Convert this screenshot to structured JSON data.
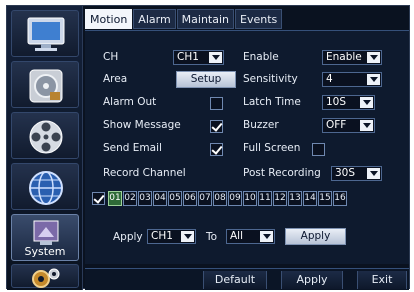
{
  "sidebar": {
    "items": [
      {
        "icon": "monitor-icon",
        "label": ""
      },
      {
        "icon": "hard-disk-icon",
        "label": ""
      },
      {
        "icon": "film-reel-icon",
        "label": ""
      },
      {
        "icon": "network-globe-icon",
        "label": ""
      },
      {
        "icon": "system-icon",
        "label": "System"
      },
      {
        "icon": "gears-icon",
        "label": ""
      }
    ]
  },
  "tabs": [
    "Motion",
    "Alarm",
    "Maintain",
    "Events"
  ],
  "form": {
    "ch_label": "CH",
    "ch_value": "CH1",
    "enable_label": "Enable",
    "enable_value": "Enable",
    "area_label": "Area",
    "setup_button": "Setup",
    "sensitivity_label": "Sensitivity",
    "sensitivity_value": "4",
    "alarm_out_label": "Alarm Out",
    "alarm_out_checked": false,
    "latch_time_label": "Latch Time",
    "latch_time_value": "10S",
    "show_message_label": "Show Message",
    "show_message_checked": true,
    "buzzer_label": "Buzzer",
    "buzzer_value": "OFF",
    "send_email_label": "Send Email",
    "send_email_checked": true,
    "full_screen_label": "Full Screen",
    "full_screen_checked": false,
    "record_channel_label": "Record Channel",
    "post_recording_label": "Post Recording",
    "post_recording_value": "30S",
    "all_channels_checked": true,
    "channels": [
      "01",
      "02",
      "03",
      "04",
      "05",
      "06",
      "07",
      "08",
      "09",
      "10",
      "11",
      "12",
      "13",
      "14",
      "15",
      "16"
    ],
    "selected_channel": "01"
  },
  "apply_row": {
    "apply_label": "Apply",
    "from_value": "CH1",
    "to_label": "To",
    "to_value": "All",
    "apply_button": "Apply"
  },
  "bottom": {
    "default_button": "Default",
    "apply_button": "Apply",
    "exit_button": "Exit"
  }
}
